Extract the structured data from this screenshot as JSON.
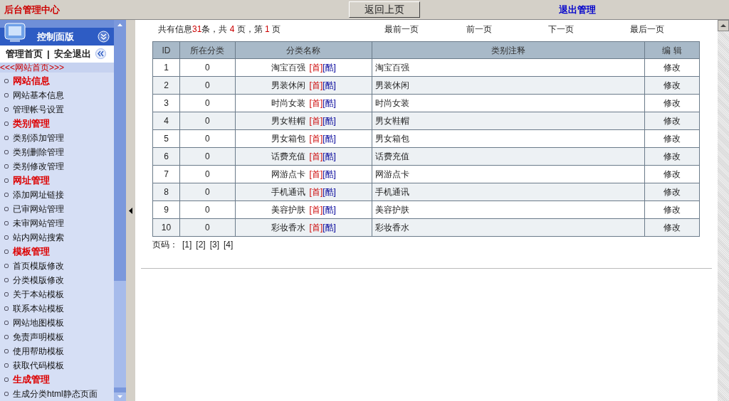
{
  "top_bar": {
    "title": "后台管理中心",
    "back_button": "返回上页",
    "logout_link": "退出管理"
  },
  "sidebar": {
    "panel_title": "控制面版",
    "nav_links": [
      "管理首页",
      "|",
      "安全退出"
    ],
    "home_link": "<<<网站首页>>>",
    "items": [
      {
        "label": "网站信息",
        "kind": "heading"
      },
      {
        "label": "网站基本信息",
        "kind": "link"
      },
      {
        "label": "管理帐号设置",
        "kind": "link"
      },
      {
        "label": "类别管理",
        "kind": "heading"
      },
      {
        "label": "类别添加管理",
        "kind": "link"
      },
      {
        "label": "类别删除管理",
        "kind": "link"
      },
      {
        "label": "类别修改管理",
        "kind": "link"
      },
      {
        "label": "网址管理",
        "kind": "heading"
      },
      {
        "label": "添加网址链接",
        "kind": "link"
      },
      {
        "label": "已审网站管理",
        "kind": "link"
      },
      {
        "label": "未审网站管理",
        "kind": "link"
      },
      {
        "label": "站内网站搜索",
        "kind": "link"
      },
      {
        "label": "模板管理",
        "kind": "heading"
      },
      {
        "label": "首页模版修改",
        "kind": "link"
      },
      {
        "label": "分类模版修改",
        "kind": "link"
      },
      {
        "label": "关于本站模板",
        "kind": "link"
      },
      {
        "label": "联系本站模板",
        "kind": "link"
      },
      {
        "label": "网站地图模板",
        "kind": "link"
      },
      {
        "label": "免责声明模板",
        "kind": "link"
      },
      {
        "label": "使用帮助模板",
        "kind": "link"
      },
      {
        "label": "获取代码模板",
        "kind": "link"
      },
      {
        "label": "生成管理",
        "kind": "heading"
      },
      {
        "label": "生成分类html静态页面",
        "kind": "link"
      }
    ]
  },
  "summary": [
    {
      "text": "共有信息",
      "highlight": false
    },
    {
      "text": "31",
      "highlight": true
    },
    {
      "text": "条，共 ",
      "highlight": false
    },
    {
      "text": "4",
      "highlight": true
    },
    {
      "text": " 页，第 ",
      "highlight": false
    },
    {
      "text": "1",
      "highlight": true
    },
    {
      "text": " 页",
      "highlight": false
    }
  ],
  "pager_links": [
    "最前一页",
    "前一页",
    "下一页",
    "最后一页"
  ],
  "table": {
    "columns": [
      "ID",
      "所在分类",
      "分类名称",
      "类别注释",
      "编 辑"
    ],
    "rows": [
      {
        "id": "1",
        "category": "0",
        "name": "淘宝百强",
        "links": [
          {
            "text": "[首]",
            "kind": "front"
          },
          {
            "text": "[酷]",
            "kind": "cool"
          }
        ],
        "note": "淘宝百强",
        "edit": "修改"
      },
      {
        "id": "2",
        "category": "0",
        "name": "男装休闲",
        "links": [
          {
            "text": "[首]",
            "kind": "front"
          },
          {
            "text": "[酷]",
            "kind": "cool"
          }
        ],
        "note": "男装休闲",
        "edit": "修改"
      },
      {
        "id": "3",
        "category": "0",
        "name": "时尚女装",
        "links": [
          {
            "text": "[首]",
            "kind": "front"
          },
          {
            "text": "[酷]",
            "kind": "cool"
          }
        ],
        "note": "时尚女装",
        "edit": "修改"
      },
      {
        "id": "4",
        "category": "0",
        "name": "男女鞋帽",
        "links": [
          {
            "text": "[首]",
            "kind": "front"
          },
          {
            "text": "[酷]",
            "kind": "cool"
          }
        ],
        "note": "男女鞋帽",
        "edit": "修改"
      },
      {
        "id": "5",
        "category": "0",
        "name": "男女箱包",
        "links": [
          {
            "text": "[首]",
            "kind": "front"
          },
          {
            "text": "[酷]",
            "kind": "cool"
          }
        ],
        "note": "男女箱包",
        "edit": "修改"
      },
      {
        "id": "6",
        "category": "0",
        "name": "话费充值",
        "links": [
          {
            "text": "[首]",
            "kind": "front"
          },
          {
            "text": "[酷]",
            "kind": "cool"
          }
        ],
        "note": "话费充值",
        "edit": "修改"
      },
      {
        "id": "7",
        "category": "0",
        "name": "网游点卡",
        "links": [
          {
            "text": "[首]",
            "kind": "front"
          },
          {
            "text": "[酷]",
            "kind": "cool"
          }
        ],
        "note": "网游点卡",
        "edit": "修改"
      },
      {
        "id": "8",
        "category": "0",
        "name": "手机通讯",
        "links": [
          {
            "text": "[首]",
            "kind": "front"
          },
          {
            "text": "[酷]",
            "kind": "cool"
          }
        ],
        "note": "手机通讯",
        "edit": "修改"
      },
      {
        "id": "9",
        "category": "0",
        "name": "美容护肤",
        "links": [
          {
            "text": "[首]",
            "kind": "front"
          },
          {
            "text": "[酷]",
            "kind": "cool"
          }
        ],
        "note": "美容护肤",
        "edit": "修改"
      },
      {
        "id": "10",
        "category": "0",
        "name": "彩妆香水",
        "links": [
          {
            "text": "[首]",
            "kind": "front"
          },
          {
            "text": "[酷]",
            "kind": "cool"
          }
        ],
        "note": "彩妆香水",
        "edit": "修改"
      }
    ]
  },
  "page_numbers": {
    "label": "页码：",
    "pages": [
      "[1]",
      "[2]",
      "[3]",
      "[4]"
    ]
  }
}
